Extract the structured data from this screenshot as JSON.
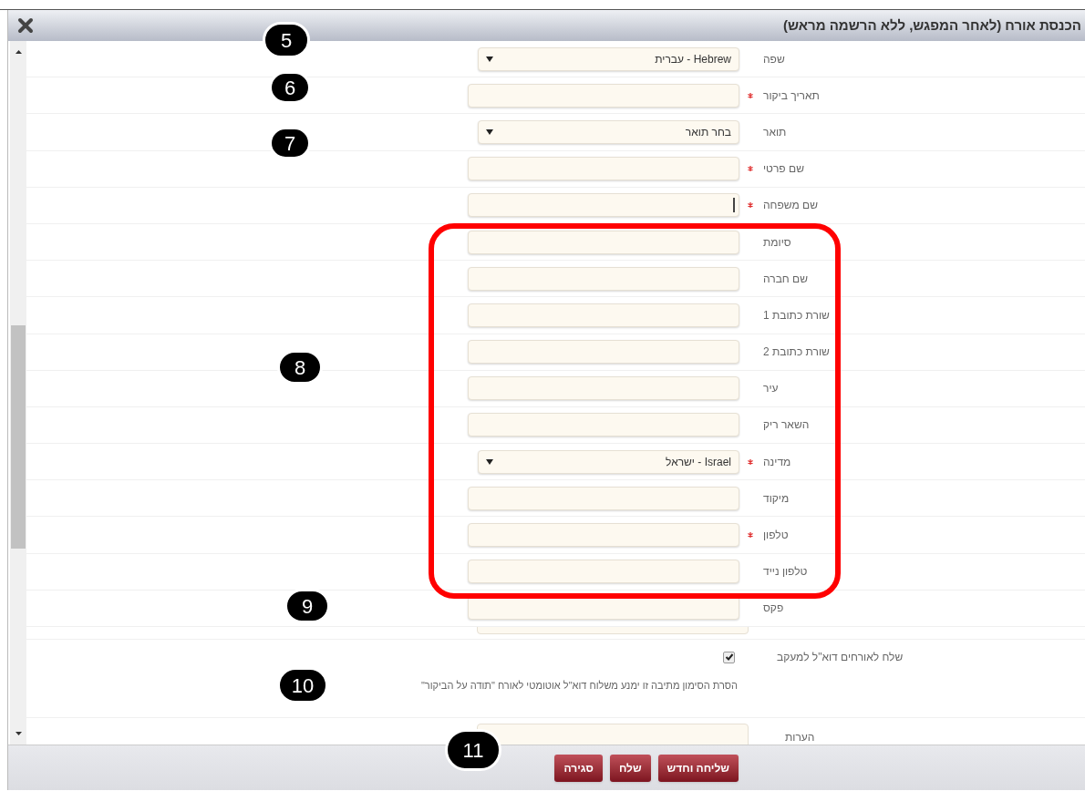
{
  "dialog": {
    "title": "הכנסת אורח (לאחר המפגש, ללא הרשמה מראש)",
    "fields": [
      {
        "kind": "select",
        "label": "שפה",
        "required": false,
        "value": "Hebrew - עברית"
      },
      {
        "kind": "text",
        "label": "תאריך ביקור",
        "required": true,
        "focused": false
      },
      {
        "kind": "select",
        "label": "תואר",
        "required": false,
        "value": "בחר תואר"
      },
      {
        "kind": "text",
        "label": "שם פרטי",
        "required": true,
        "focused": false
      },
      {
        "kind": "text",
        "label": "שם משפחה",
        "required": true,
        "focused": true
      },
      {
        "kind": "text",
        "label": "סיומת",
        "required": false,
        "focused": false
      },
      {
        "kind": "text",
        "label": "שם חברה",
        "required": false,
        "focused": false
      },
      {
        "kind": "text",
        "label": "שורת כתובת 1",
        "required": false,
        "focused": false
      },
      {
        "kind": "text",
        "label": "שורת כתובת 2",
        "required": false,
        "focused": false
      },
      {
        "kind": "text",
        "label": "עיר",
        "required": false,
        "focused": false
      },
      {
        "kind": "text",
        "label": "השאר ריק",
        "required": false,
        "focused": false
      },
      {
        "kind": "select",
        "label": "מדינה",
        "required": true,
        "value": "Israel - ישראל"
      },
      {
        "kind": "text",
        "label": "מיקוד",
        "required": false,
        "focused": false
      },
      {
        "kind": "text",
        "label": "טלפון",
        "required": true,
        "focused": false
      },
      {
        "kind": "text",
        "label": "טלפון נייד",
        "required": false,
        "focused": false
      },
      {
        "kind": "text",
        "label": "פקס",
        "required": false,
        "focused": false
      }
    ],
    "follow_up": {
      "label": "שלח לאורחים דוא\"ל למעקב",
      "checked": true,
      "note": "הסרת הסימון מתיבה זו ימנע משלוח דוא\"ל אוטומטי לאורח \"תודה על הביקור\""
    },
    "comments": {
      "label": "הערות"
    },
    "buttons": [
      "שליחה וחדש",
      "שלח",
      "סגירה"
    ]
  },
  "annotations": [
    "5",
    "6",
    "7",
    "8",
    "9",
    "10",
    "11"
  ]
}
